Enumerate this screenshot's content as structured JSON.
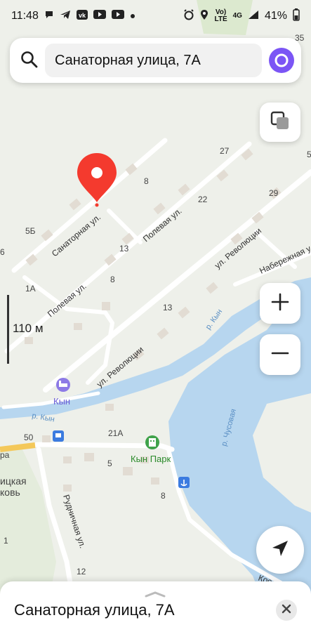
{
  "status": {
    "time": "11:48",
    "network_top": "Vo)",
    "network_bottom": "LTE",
    "signal": "4G",
    "battery": "41%",
    "notifications": [
      "message-icon",
      "telegram-icon",
      "vk-icon",
      "youtube-icon",
      "youtube-icon",
      "dot-icon"
    ],
    "right_icons": [
      "alarm-icon",
      "location-icon",
      "wifi-icon",
      "signal-icon",
      "battery-icon"
    ]
  },
  "search": {
    "query": "Санаторная улица, 7А"
  },
  "map": {
    "scale_label": "110 м",
    "streets": {
      "sanatornaya": "Санаторная ул.",
      "polevaya_1": "Полевая ул.",
      "polevaya_2": "Полевая ул.",
      "revolyutsii_1": "ул. Революции",
      "revolyutsii_2": "ул. Революции",
      "naberezhnaya": "Набережная у",
      "rudnichnaya": "Рудничная ул.",
      "kos": "Кос"
    },
    "rivers": {
      "kyn_1": "р. Кын",
      "kyn_2": "р. Кын",
      "chusovaya": "р. Чусовая"
    },
    "pois": {
      "kyn": "Кын",
      "kyn_park": "Кын Парк",
      "church_1": "ицкая",
      "church_2": "ковь"
    },
    "house_numbers": [
      "8",
      "27",
      "22",
      "29",
      "5Б",
      "13",
      "8",
      "1А",
      "13",
      "6",
      "21А",
      "5",
      "50",
      "8",
      "1",
      "12",
      "5",
      "35",
      "ра"
    ]
  },
  "bottom_sheet": {
    "title": "Санаторная улица, 7А"
  },
  "colors": {
    "pin": "#f43a2e",
    "alice": "#7b55f5",
    "water": "#b7d6ef",
    "park": "#c6e8c0",
    "map_bg": "#eef0ea",
    "road": "#ffffff"
  }
}
